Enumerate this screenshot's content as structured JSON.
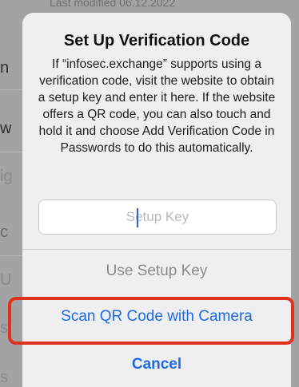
{
  "background": {
    "top_text": "Last modified 06.12.2022",
    "edge_letters": [
      "n",
      "w",
      "ig",
      "c",
      "U",
      "si",
      "s"
    ]
  },
  "alert": {
    "title": "Set Up Verification Code",
    "message": "If “infosec.exchange” supports using a verification code, visit the website to obtain a setup key and enter it here. If the website offers a QR code, you can also touch and hold it and choose Add Verification Code in Passwords to do this automatically.",
    "input": {
      "value": "",
      "placeholder": "Setup Key"
    },
    "actions": {
      "use_setup_key": "Use Setup Key",
      "scan_qr": "Scan QR Code with Camera",
      "cancel": "Cancel"
    }
  },
  "colors": {
    "accent": "#1f6be0",
    "highlight": "#e0311f",
    "disabled_text": "#8a8a8e"
  }
}
